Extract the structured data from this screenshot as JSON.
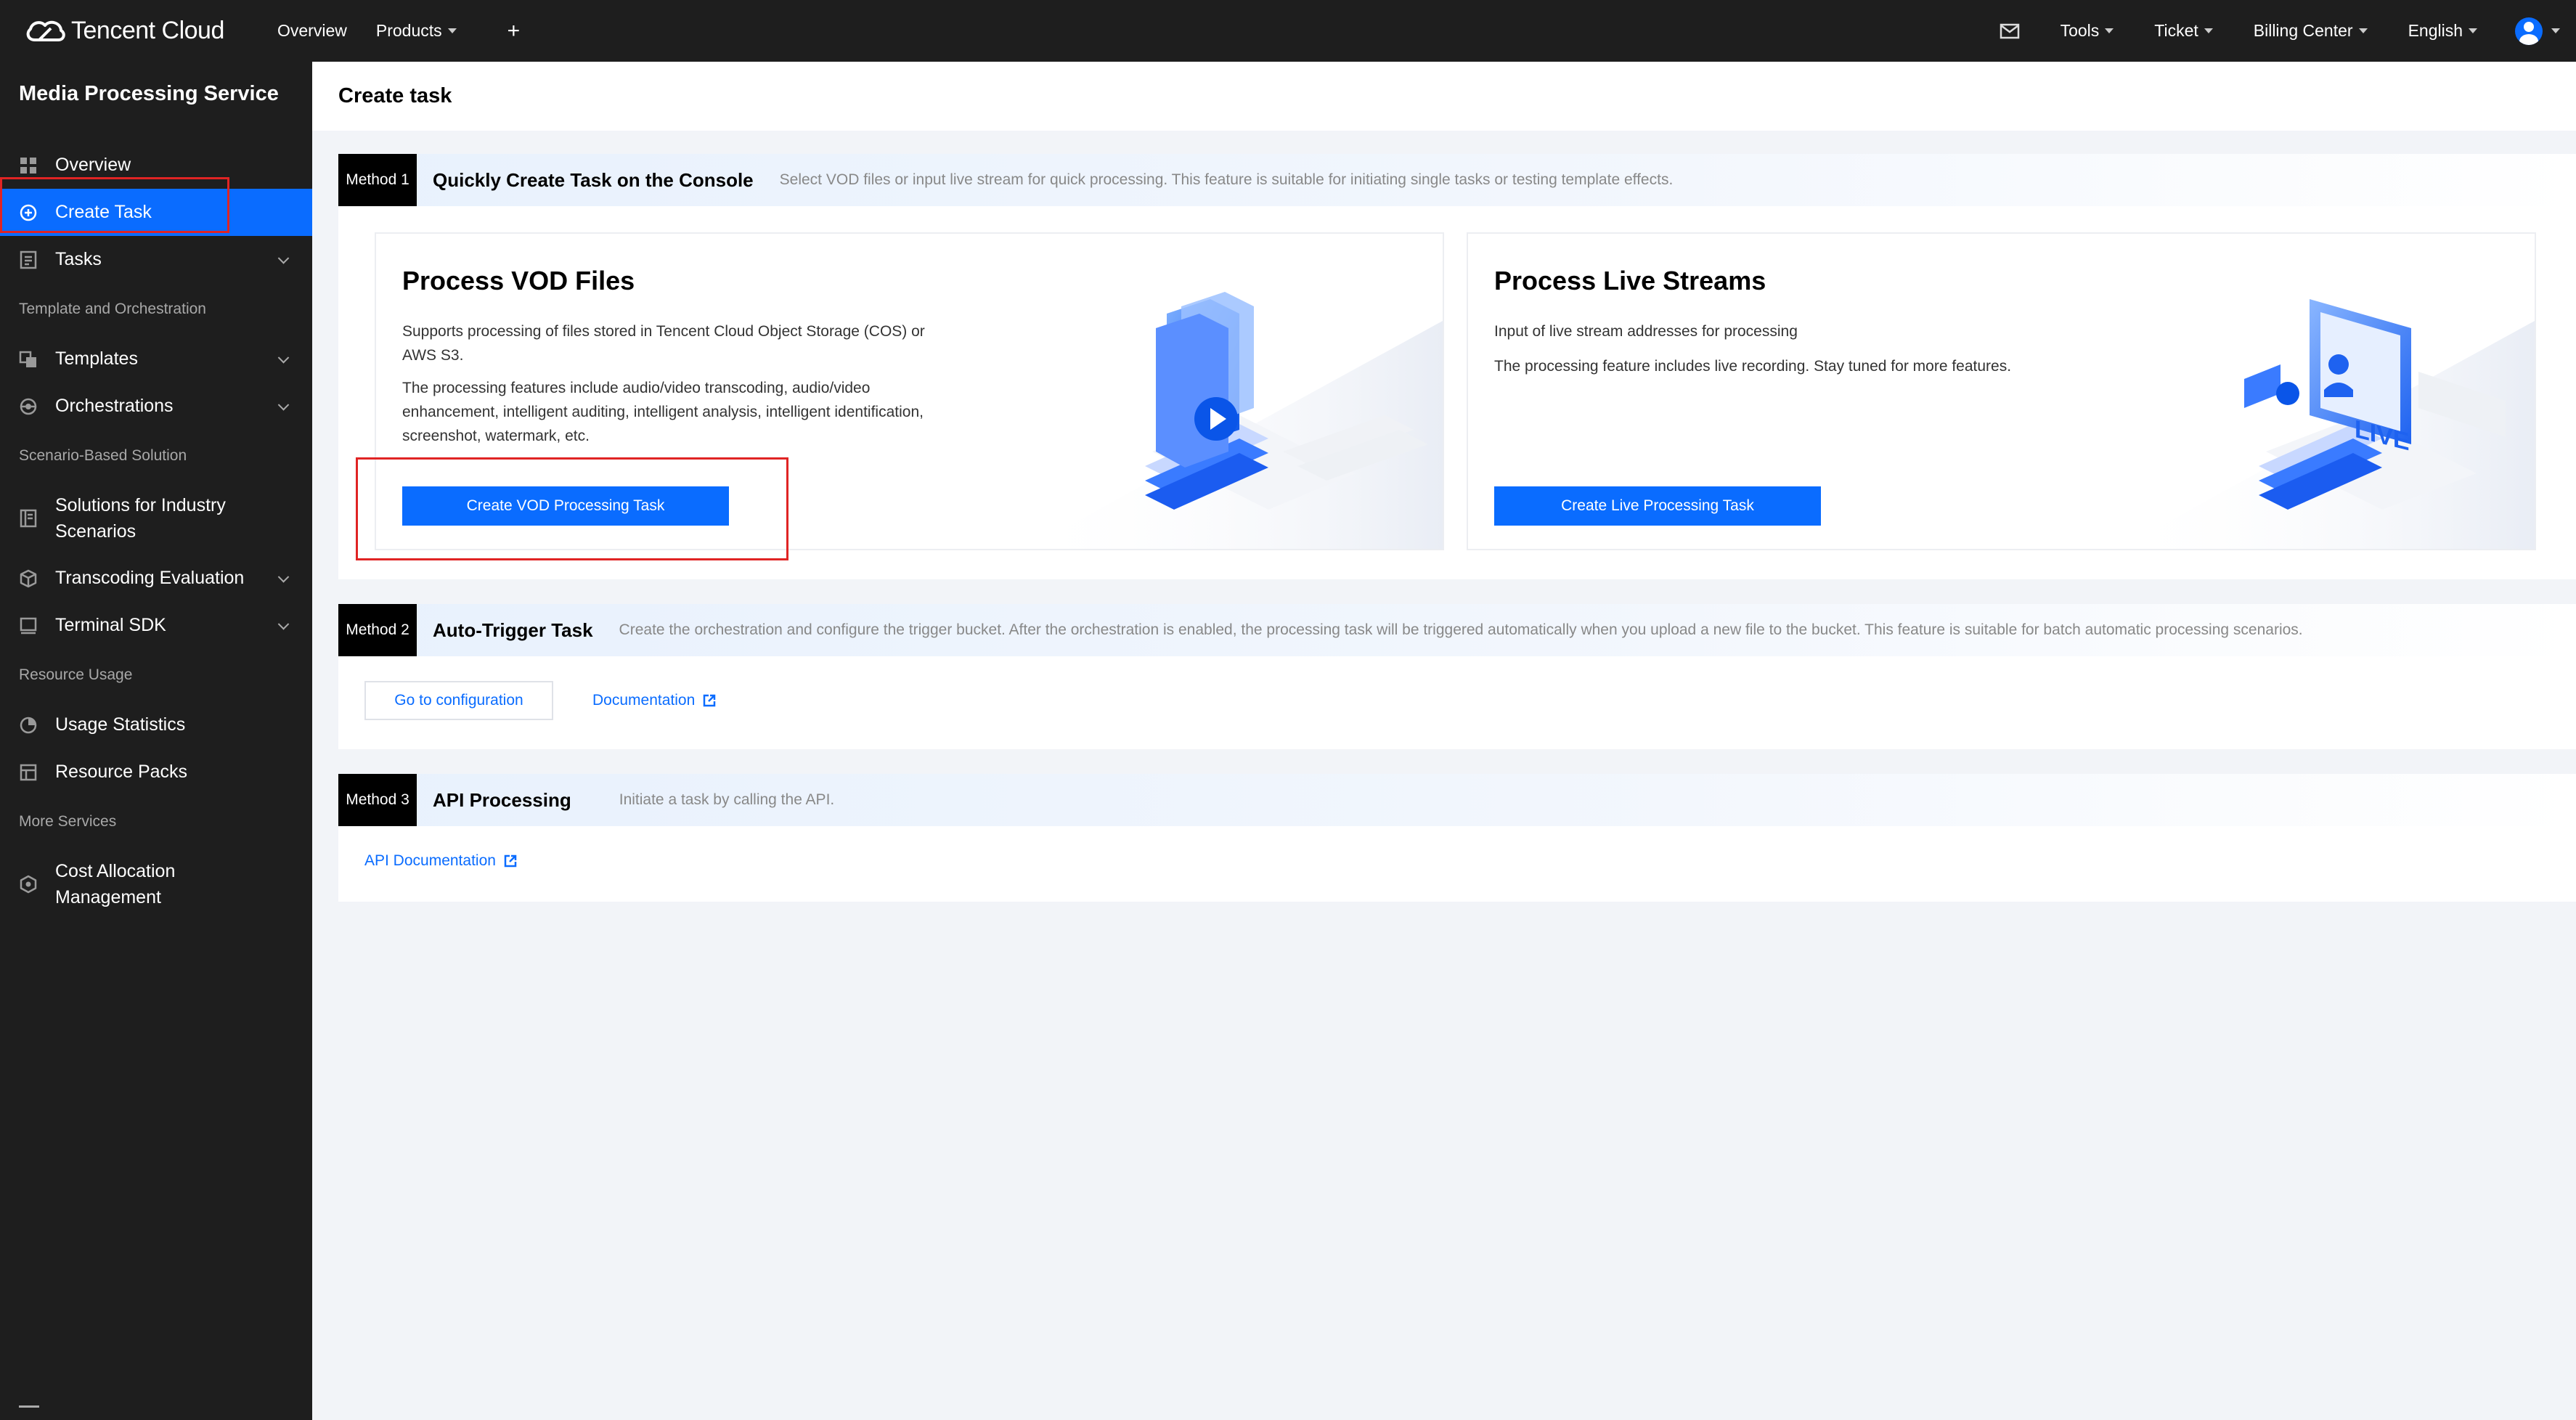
{
  "topbar": {
    "brand": "Tencent Cloud",
    "nav_left": [
      "Overview",
      "Products"
    ],
    "nav_right": [
      "Tools",
      "Ticket",
      "Billing Center",
      "English"
    ],
    "plus": "+"
  },
  "sidebar": {
    "title": "Media Processing Service",
    "items": {
      "overview": "Overview",
      "create_task": "Create Task",
      "tasks": "Tasks",
      "group_template": "Template and Orchestration",
      "templates": "Templates",
      "orchestrations": "Orchestrations",
      "group_scenario": "Scenario-Based Solution",
      "solutions": "Solutions for Industry Scenarios",
      "transcoding": "Transcoding Evaluation",
      "terminal": "Terminal SDK",
      "group_resource": "Resource Usage",
      "usage": "Usage Statistics",
      "packs": "Resource Packs",
      "group_more": "More Services",
      "cost": "Cost Allocation Management"
    }
  },
  "page": {
    "title": "Create task"
  },
  "method1": {
    "tag": "Method 1",
    "title": "Quickly Create Task on the Console",
    "desc": "Select VOD files or input live stream for quick processing. This feature is suitable for initiating single tasks or testing template effects.",
    "vod": {
      "title": "Process VOD Files",
      "text1": "Supports processing of files stored in Tencent Cloud Object Storage (COS) or AWS S3.",
      "text2": "The processing features include audio/video transcoding, audio/video enhancement, intelligent auditing, intelligent analysis, intelligent identification, screenshot, watermark, etc.",
      "button": "Create VOD Processing Task"
    },
    "live": {
      "title": "Process Live Streams",
      "text1": "Input of live stream addresses for processing",
      "text2": "The processing feature includes live recording. Stay tuned for more features.",
      "button": "Create Live Processing Task",
      "art_label": "LIVE"
    }
  },
  "method2": {
    "tag": "Method 2",
    "title": "Auto-Trigger Task",
    "desc": "Create the orchestration and configure the trigger bucket. After the orchestration is enabled, the processing task will be triggered automatically when you upload a new file to the bucket. This feature is suitable for batch automatic processing scenarios.",
    "config_button": "Go to configuration",
    "doc_link": "Documentation"
  },
  "method3": {
    "tag": "Method 3",
    "title": "API Processing",
    "desc": "Initiate a task by calling the API.",
    "doc_link": "API Documentation"
  },
  "colors": {
    "accent": "#0a6cff",
    "topbar": "#1e1e1e",
    "highlight": "#e02424"
  },
  "icons": [
    "cloud-logo-icon",
    "mail-icon",
    "user-icon",
    "grid-icon",
    "plus-circle-icon",
    "list-icon",
    "template-icon",
    "orchestration-icon",
    "book-icon",
    "cube-icon",
    "device-icon",
    "pie-icon",
    "package-icon",
    "hexagon-icon",
    "external-link-icon",
    "menu-icon"
  ]
}
